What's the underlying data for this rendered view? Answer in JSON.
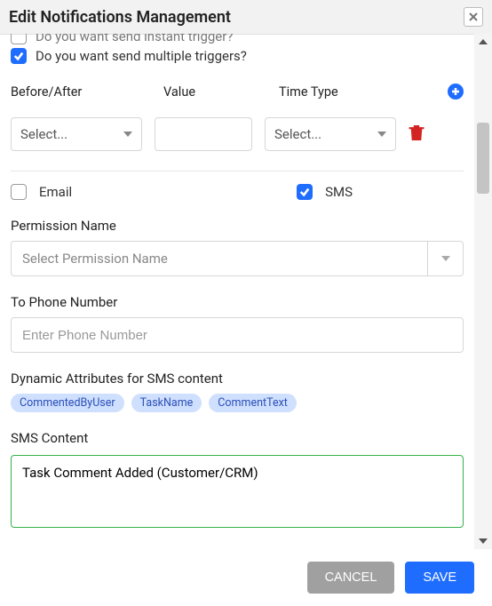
{
  "dialog": {
    "title": "Edit Notifications Management"
  },
  "triggers": {
    "instant_label": "Do you want send instant trigger?",
    "multiple_label": "Do you want send multiple triggers?",
    "cols": {
      "before_after": "Before/After",
      "value": "Value",
      "time_type": "Time Type"
    },
    "placeholder": "Select..."
  },
  "channels": {
    "email": "Email",
    "sms": "SMS"
  },
  "permission": {
    "label": "Permission Name",
    "placeholder": "Select Permission Name"
  },
  "phone": {
    "label": "To Phone Number",
    "placeholder": "Enter Phone Number",
    "value": ""
  },
  "dyn": {
    "label": "Dynamic Attributes for SMS content",
    "chips": [
      "CommentedByUser",
      "TaskName",
      "CommentText"
    ]
  },
  "sms": {
    "label": "SMS Content",
    "value": "Task Comment Added (Customer/CRM)"
  },
  "footer": {
    "cancel": "CANCEL",
    "save": "SAVE"
  }
}
